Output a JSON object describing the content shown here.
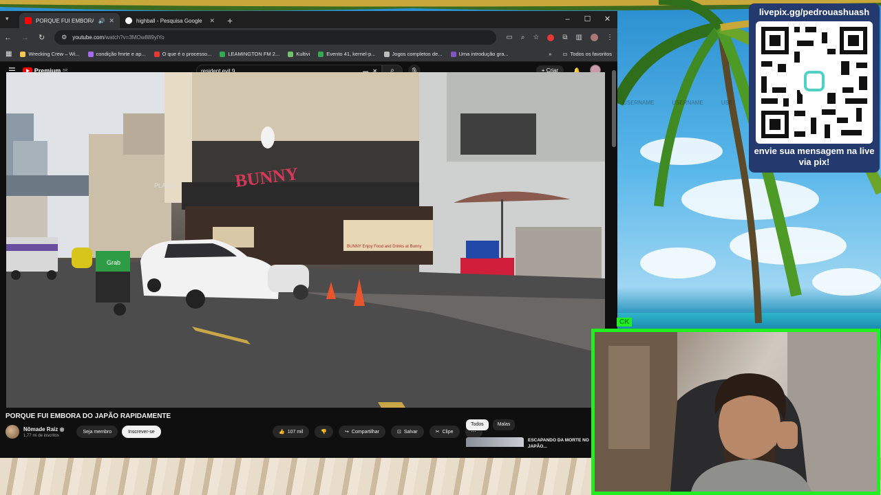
{
  "browser": {
    "tabs": [
      {
        "title": "PORQUE FUI EMBORA DO",
        "active": true,
        "favicon_color": "#ff0000"
      },
      {
        "title": "highball - Pesquisa Google",
        "active": false,
        "favicon_color": "#4285f4"
      }
    ],
    "url_host": "youtube.com",
    "url_path": "/watch?v=3MOw889ylYo",
    "bookmarks": [
      {
        "label": "Wrecking Crew – Wi...",
        "color": "#f2c94c"
      },
      {
        "label": "condição fmrte e ap...",
        "color": "#a66cf0"
      },
      {
        "label": "O que é o processo...",
        "color": "#e53935"
      },
      {
        "label": "LEAMINGTON FM 2...",
        "color": "#34a853"
      },
      {
        "label": "Kultivi",
        "color": "#6fc36f"
      },
      {
        "label": "Evento 41, kernel-p...",
        "color": "#34a853"
      },
      {
        "label": "Jogos completos de...",
        "color": "#bdbdbd"
      },
      {
        "label": "Uma introdução gra...",
        "color": "#7e57c2"
      }
    ],
    "all_favorites": "Todos os favoritos"
  },
  "youtube": {
    "logo_text": "Premium",
    "logo_region": "BR",
    "search_query": "resident evil 9",
    "create_label": "Criar",
    "video_title": "PORQUE FUI EMBORA DO JAPÃO RAPIDAMENTE",
    "channel_name": "Nômade Raiz",
    "channel_subs": "1,77 mi de inscritos",
    "join_label": "Seja membro",
    "subscribe_label": "Inscrever-se",
    "likes": "107 mil",
    "share_label": "Compartilhar",
    "save_label": "Salvar",
    "clip_label": "Clipe",
    "chips": [
      "Todos",
      "Malas"
    ],
    "rec_title": "ESCAPANDO DA MORTE NO JAPÃO..."
  },
  "scene": {
    "bar_sign": "BUNNY",
    "banner_text": "BUNNY Enjoy Food and Drinks at Bunny",
    "plaza_sign": "PLAZA",
    "grab_box": "Grab"
  },
  "stream": {
    "livepix_url": "livepix.gg/pedrouashuash",
    "livepix_cta": "envie sua mensagem na live via pix!",
    "username_placeholders": [
      "USERNAME",
      "USERNAME",
      "USE"
    ],
    "cam_label": "CK"
  }
}
